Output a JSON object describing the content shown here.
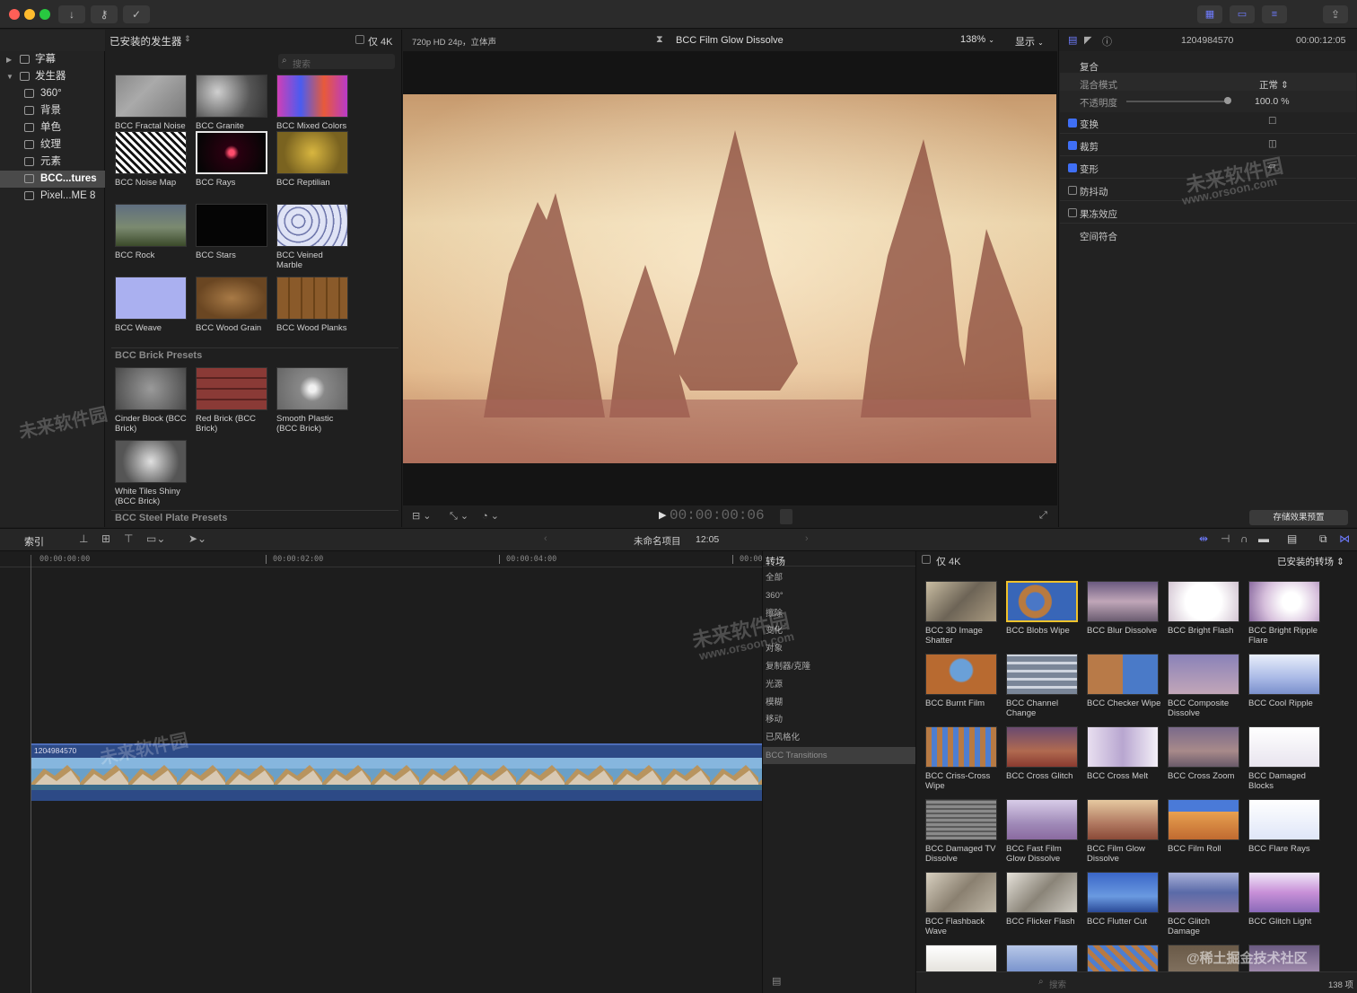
{
  "toolbar": {
    "colors": {
      "close": "#ff5f57",
      "minimize": "#febc2e",
      "zoom": "#28c840"
    },
    "import_icon": "download-arrow",
    "keywords_icon": "key-icon",
    "background_tasks_icon": "checkmark-circle",
    "view_icons": [
      "grid-browser",
      "timeline-layout",
      "inspector-sliders"
    ],
    "share_icon": "share-icon"
  },
  "library": {
    "icons": [
      "clapper-icon",
      "photos-icon",
      "generators-icon"
    ],
    "title": "已安装的发生器",
    "only4k": "仅 4K",
    "search_placeholder": "搜索",
    "tree": [
      {
        "label": "字幕",
        "level": 0,
        "arrow": "▶"
      },
      {
        "label": "发生器",
        "level": 0,
        "arrow": "▼"
      },
      {
        "label": "360°",
        "level": 1
      },
      {
        "label": "背景",
        "level": 1
      },
      {
        "label": "单色",
        "level": 1
      },
      {
        "label": "纹理",
        "level": 1
      },
      {
        "label": "元素",
        "level": 1
      },
      {
        "label": "BCC...tures",
        "level": 1,
        "selected": true
      },
      {
        "label": "Pixel...ME 8",
        "level": 1
      }
    ]
  },
  "generators": {
    "items": [
      {
        "label": "BCC Fractal Noise",
        "color": "linear-gradient(135deg,#8a8a8a,#aaaaaa 40%,#7a7a7a)"
      },
      {
        "label": "BCC Granite",
        "color": "radial-gradient(circle at 30% 40%,#cfcfcf,#555 60%,#333)"
      },
      {
        "label": "BCC Mixed Colors",
        "color": "linear-gradient(90deg,#d03fb6,#4a5cf0,#e85a3a,#b93ac9)"
      },
      {
        "label": "BCC Noise Map",
        "color": "repeating-linear-gradient(45deg,#fff 0 3px,#111 3px 6px)"
      },
      {
        "label": "BCC Rays",
        "color": "radial-gradient(circle,#ff4d6d 0 3px,#2a0010 8px,#050505 40px)"
      },
      {
        "label": "BCC Reptilian",
        "color": "radial-gradient(circle at 50% 50%,#d8b640,#7a6320 70%)"
      },
      {
        "label": "BCC Rock",
        "color": "linear-gradient(180deg,#5f6e80,#7b8a70 55%,#3b4a2a)"
      },
      {
        "label": "BCC Stars",
        "color": "#050505"
      },
      {
        "label": "BCC Veined Marble",
        "color": "repeating-radial-gradient(circle at 30% 40%,#dfe3f5 0 6px,#6a72a8 7px 8px)"
      },
      {
        "label": "BCC Weave",
        "color": "#aab0f0"
      },
      {
        "label": "BCC Wood Grain",
        "color": "radial-gradient(ellipse at 50% 50%,#a87a46,#6a4622 70%)"
      },
      {
        "label": "BCC Wood Planks",
        "color": "repeating-linear-gradient(90deg,#8a5a2a 0 12px,#6a4218 12px 14px)"
      }
    ],
    "section_brick": "BCC Brick Presets",
    "brick_items": [
      {
        "label": "Cinder Block (BCC Brick)",
        "color": "radial-gradient(circle,#9a9a9a,#4a4a4a)"
      },
      {
        "label": "Red Brick (BCC Brick)",
        "color": "repeating-linear-gradient(0deg,#8a3a36 0 10px,#5a2220 10px 12px)"
      },
      {
        "label": "Smooth Plastic (BCC Brick)",
        "color": "radial-gradient(circle,#f0f0f0 0 4px,#888 14px,#666)"
      },
      {
        "label": "White Tiles Shiny (BCC Brick)",
        "color": "radial-gradient(circle,#e0e0e0,#555 70%)"
      }
    ],
    "section_steel": "BCC Steel Plate Presets"
  },
  "viewer": {
    "format": "720p HD 24p，立体声",
    "title": "BCC Film Glow Dissolve",
    "zoom": "138%",
    "display": "显示",
    "timecode": "00:00:00:06",
    "frame_colors": {
      "light": "#e8cfa4",
      "mid": "#c79a6e",
      "dark": "#7a3a2e"
    }
  },
  "inspector": {
    "clip_name": "1204984570",
    "duration": "00:00:12:05",
    "compositing": "复合",
    "blend_mode_label": "混合模式",
    "blend_mode_value": "正常",
    "opacity_label": "不透明度",
    "opacity_value": "100.0 %",
    "rows": [
      {
        "label": "变换",
        "checked": true
      },
      {
        "label": "裁剪",
        "checked": true
      },
      {
        "label": "变形",
        "checked": true
      },
      {
        "label": "防抖动",
        "checked": false
      },
      {
        "label": "果冻效应",
        "checked": false
      },
      {
        "label": "空间符合",
        "checked": null
      }
    ],
    "save_preset": "存储效果预置"
  },
  "timeline_bar": {
    "index": "索引",
    "project": "未命名项目",
    "duration": "12:05"
  },
  "timeline": {
    "ticks": [
      "00:00:00:00",
      "00:00:02:00",
      "00:00:04:00",
      "00:00"
    ],
    "clip_label": "1204984570"
  },
  "effects": {
    "header": "转场",
    "only4k": "仅 4K",
    "installed": "已安装的转场",
    "categories": [
      "全部",
      "360°",
      "擦除",
      "变化",
      "对象",
      "复制器/克隆",
      "光源",
      "模糊",
      "移动",
      "已风格化",
      "BCC Transitions"
    ],
    "selected_category": "BCC Transitions",
    "search_placeholder": "搜索",
    "count": "138 项",
    "items": [
      {
        "label": "BCC 3D Image Shatter",
        "color": "linear-gradient(135deg,#c9bda2,#6d6456 50%,#a99a80)"
      },
      {
        "label": "BCC Blobs Wipe",
        "color": "radial-gradient(circle at 40% 50%,#4a77c6 0 10px,#b87a40 11px 18px,#3866b8 19px)",
        "selected": true
      },
      {
        "label": "BCC Blur Dissolve",
        "color": "linear-gradient(180deg,#6a5a80,#c0a6b8 50%,#6a5c70)"
      },
      {
        "label": "BCC Bright Flash",
        "color": "radial-gradient(circle,#ffffff 0 20px,#c9b8c8 50px)"
      },
      {
        "label": "BCC Bright Ripple Flare",
        "color": "radial-gradient(circle at 60% 50%,#fff 0 10px,#d7c0dc 30px,#8a6aa0)"
      },
      {
        "label": "BCC Burnt Film",
        "color": "radial-gradient(circle at 50% 40%,#6aa0d8 0 12px,#b86a30 14px)"
      },
      {
        "label": "BCC Channel Change",
        "color": "repeating-linear-gradient(0deg,#7a8698 0 6px,#cfd5df 6px 9px)"
      },
      {
        "label": "BCC Checker Wipe",
        "color": "linear-gradient(90deg,#b87a48 0 50%,#4a7ac8 50%)"
      },
      {
        "label": "BCC Composite Dissolve",
        "color": "linear-gradient(180deg,#8a82b8,#c2a6b8)"
      },
      {
        "label": "BCC Cool Ripple",
        "color": "linear-gradient(180deg,#e8eefa,#a9b9e6 60%,#7a90cc)"
      },
      {
        "label": "BCC Criss-Cross Wipe",
        "color": "repeating-linear-gradient(90deg,#b77a44 0 6px,#4e7ed0 6px 12px)"
      },
      {
        "label": "BCC Cross Glitch",
        "color": "linear-gradient(180deg,#6a4a70,#b06a50 60%,#8a3a30)"
      },
      {
        "label": "BCC Cross Melt",
        "color": "linear-gradient(90deg,#e8dff0,#b8a6d0 50%,#f4f0f8)"
      },
      {
        "label": "BCC Cross Zoom",
        "color": "linear-gradient(180deg,#7a6a8a,#a88a8a 60%,#6a5a6a)"
      },
      {
        "label": "BCC Damaged Blocks",
        "color": "linear-gradient(180deg,#ffffff,#e8e4ee)"
      },
      {
        "label": "BCC Damaged TV Dissolve",
        "color": "repeating-linear-gradient(0deg,#8a8a8a 0 3px,#5a5a5a 3px 5px)"
      },
      {
        "label": "BCC Fast Film Glow Dissolve",
        "color": "linear-gradient(180deg,#d8cce8,#a08ab8 60%,#8a6aa0)"
      },
      {
        "label": "BCC Film Glow Dissolve",
        "color": "linear-gradient(180deg,#e6c9a0,#b07860 60%,#8a4a38)"
      },
      {
        "label": "BCC Film Roll",
        "color": "linear-gradient(180deg,#4a7ad8 0 30%,#e8a050 30%,#c06a30)"
      },
      {
        "label": "BCC Flare Rays",
        "color": "linear-gradient(180deg,#ffffff,#dfe6f8)"
      },
      {
        "label": "BCC Flashback Wave",
        "color": "linear-gradient(135deg,#d8d0c0,#8a8070 50%,#c0b8a8)"
      },
      {
        "label": "BCC Flicker Flash",
        "color": "linear-gradient(135deg,#e6e2da,#8a8478 50%,#d0ccc4)"
      },
      {
        "label": "BCC Flutter Cut",
        "color": "linear-gradient(180deg,#3a66c8,#6a9ae0 60%,#2a4a98)"
      },
      {
        "label": "BCC Glitch Damage",
        "color": "linear-gradient(180deg,#a8b0d8,#5a6aa8 50%,#8a7aa8)"
      },
      {
        "label": "BCC Glitch Light",
        "color": "linear-gradient(180deg,#f0e8f8,#c890d8 50%,#8a6ab8)"
      },
      {
        "label": "",
        "color": "linear-gradient(180deg,#fff,#d8d4cc)"
      },
      {
        "label": "",
        "color": "linear-gradient(180deg,#b8c8e8,#5a7ac0)"
      },
      {
        "label": "",
        "color": "repeating-linear-gradient(45deg,#4e7ed0 0 5px,#b77a44 5px 10px)"
      },
      {
        "label": "",
        "color": "linear-gradient(180deg,#6a5a48,#8a7a68)"
      },
      {
        "label": "",
        "color": "linear-gradient(180deg,#6a5a80,#b8a0c0)"
      }
    ]
  },
  "watermarks": {
    "brand": "未来软件园",
    "url": "www.orsoon.com",
    "community": "@稀土掘金技术社区"
  }
}
